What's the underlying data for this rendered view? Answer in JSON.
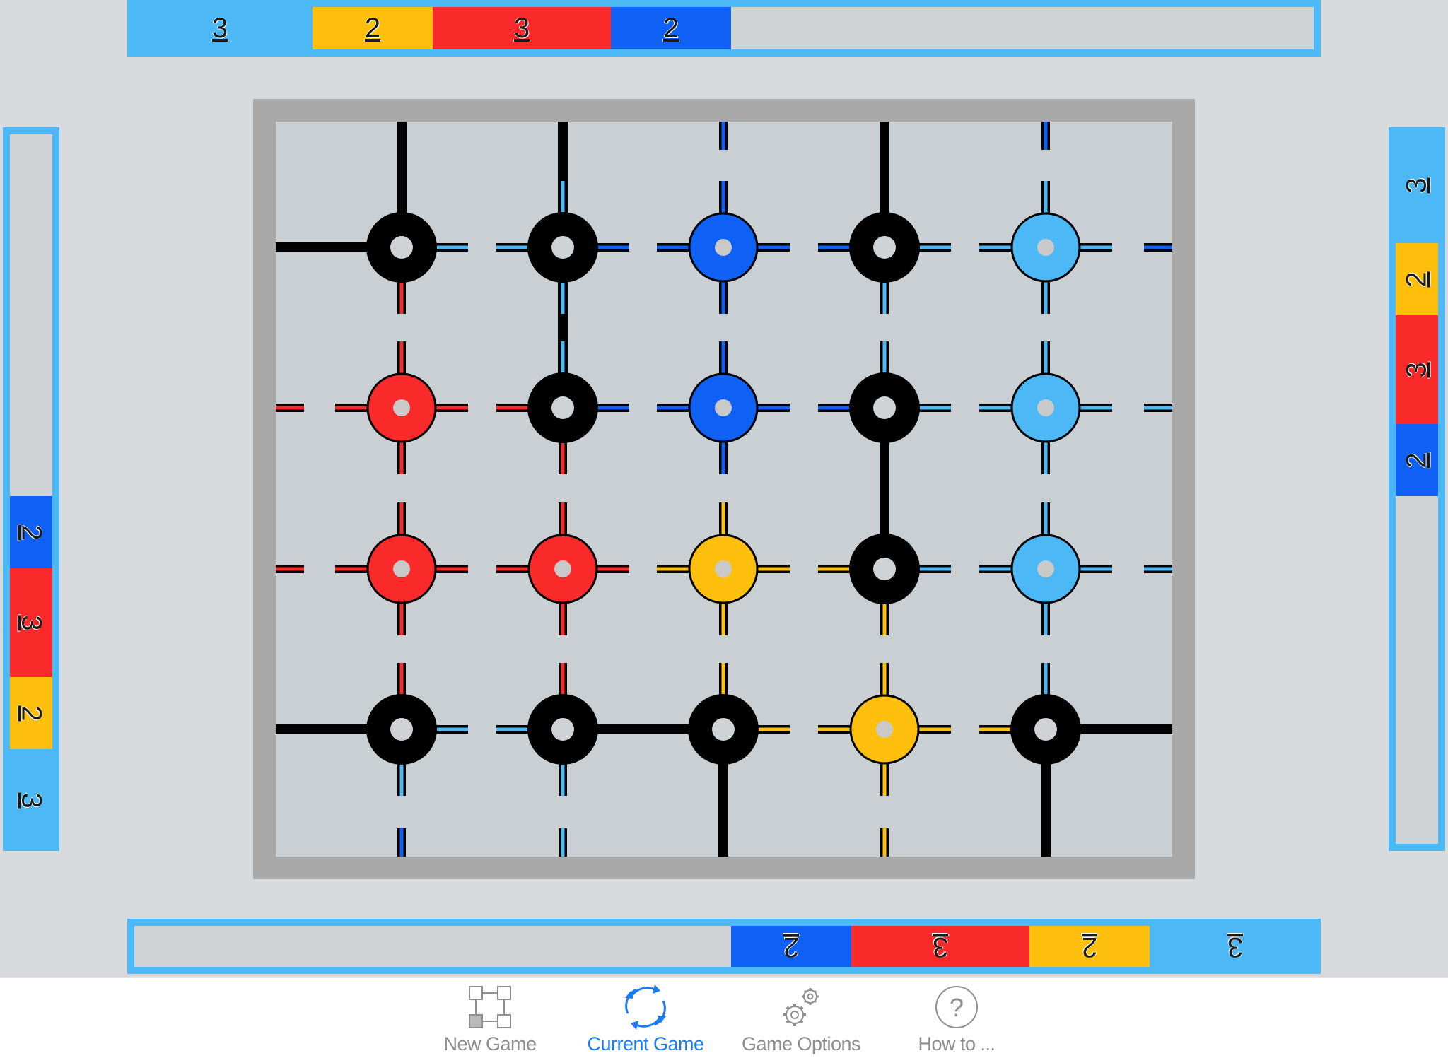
{
  "colors": {
    "sky": "#4cb8f5",
    "yellow": "#ffc00d",
    "red": "#fb2a2a",
    "blue": "#0f60f5",
    "black": "#000000",
    "board_frame": "#a9a9a9"
  },
  "score_bars": {
    "top": [
      {
        "value": "3",
        "color": "sky"
      },
      {
        "value": "2",
        "color": "yellow"
      },
      {
        "value": "3",
        "color": "red"
      },
      {
        "value": "2",
        "color": "blue"
      }
    ],
    "bottom": [
      {
        "value": "2",
        "color": "blue"
      },
      {
        "value": "3",
        "color": "red"
      },
      {
        "value": "2",
        "color": "yellow"
      },
      {
        "value": "3",
        "color": "sky"
      }
    ],
    "left": [
      {
        "value": "2",
        "color": "blue"
      },
      {
        "value": "3",
        "color": "red"
      },
      {
        "value": "2",
        "color": "yellow"
      },
      {
        "value": "3",
        "color": "sky"
      }
    ],
    "right": [
      {
        "value": "3",
        "color": "sky"
      },
      {
        "value": "2",
        "color": "yellow"
      },
      {
        "value": "3",
        "color": "red"
      },
      {
        "value": "2",
        "color": "blue"
      }
    ]
  },
  "board": {
    "rows": 4,
    "cols": 5,
    "nodes": [
      [
        "black",
        "black",
        "blue",
        "black",
        "sky"
      ],
      [
        "red",
        "black",
        "blue",
        "black",
        "sky"
      ],
      [
        "red",
        "red",
        "yellow",
        "black",
        "sky"
      ],
      [
        "black",
        "black",
        "black",
        "yellow",
        "black"
      ]
    ]
  },
  "tabs": [
    {
      "label": "New Game",
      "icon": "new-game-icon",
      "active": false
    },
    {
      "label": "Current Game",
      "icon": "refresh-icon",
      "active": true
    },
    {
      "label": "Game Options",
      "icon": "gears-icon",
      "active": false
    },
    {
      "label": "How to ...",
      "icon": "help-icon",
      "active": false
    }
  ]
}
